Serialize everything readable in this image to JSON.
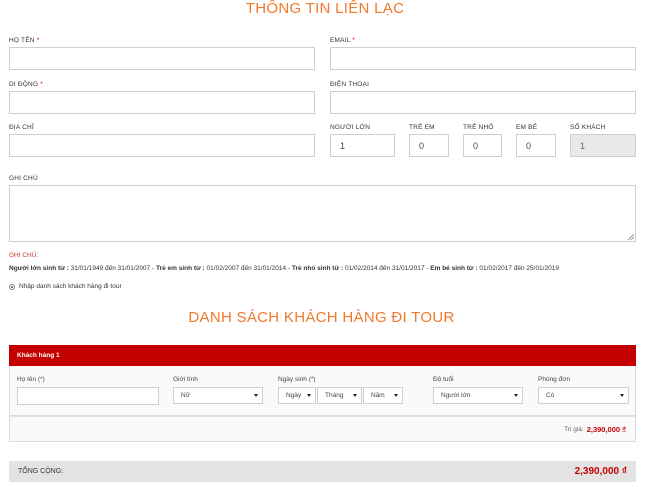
{
  "contact": {
    "title": "THÔNG TIN LIÊN LẠC",
    "name_label": "HỌ TÊN",
    "email_label": "EMAIL",
    "mobile_label": "DI ĐỘNG",
    "phone_label": "ĐIỆN THOẠI",
    "address_label": "ĐỊA CHỈ",
    "adults_label": "NGƯỜI LỚN",
    "children_label": "TRẺ EM",
    "kids_label": "TRẺ NHỎ",
    "infants_label": "EM BÉ",
    "guests_label": "SỐ KHÁCH",
    "adults_value": "1",
    "children_value": "0",
    "kids_value": "0",
    "infants_value": "0",
    "guests_value": "1",
    "notes_label": "GHI CHÚ",
    "required_mark": "*"
  },
  "note": {
    "heading": "GHI CHÚ:",
    "adult_label": "Người lớn sinh từ :",
    "adult_range": "31/01/1949 đến 31/01/2007",
    "child_label": "Trẻ em sinh từ :",
    "child_range": "01/02/2007 đến 31/01/2014",
    "kid_label": "Trẻ nhỏ sinh từ :",
    "kid_range": "01/02/2014 đến 31/01/2017",
    "infant_label": "Em bé sinh từ :",
    "infant_range": "01/02/2017 đến 25/01/2019",
    "sep": " - "
  },
  "option": {
    "enter_list": "Nhập danh sách khách hàng đi tour"
  },
  "customers": {
    "title": "DANH SÁCH KHÁCH HÀNG ĐI TOUR",
    "item_title": "Khách hàng 1",
    "fullname_label": "Họ tên (*)",
    "gender_label": "Giới tính",
    "gender_value": "Nữ",
    "dob_label": "Ngày sinh (*)",
    "day_value": "Ngày",
    "month_value": "Tháng",
    "year_value": "Năm",
    "age_label": "Độ tuổi",
    "age_value": "Người lớn",
    "single_room_label": "Phòng đơn",
    "single_room_value": "Có",
    "price_label": "Trị giá:",
    "price_value": "2,390,000 ₫"
  },
  "total": {
    "label": "TỔNG CỘNG:",
    "value": "2,390,000 ₫"
  }
}
